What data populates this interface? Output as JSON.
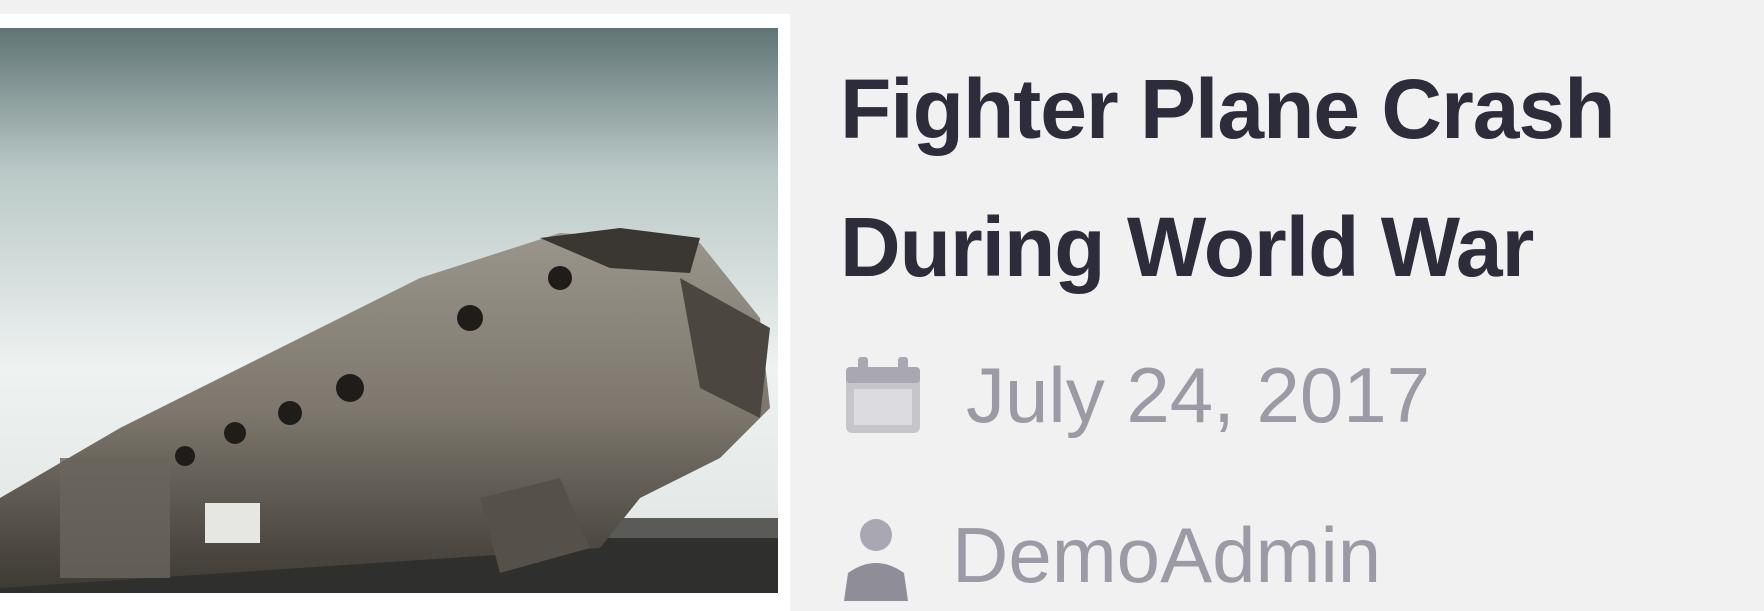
{
  "post": {
    "title": "Fighter Plane Crash During World War",
    "date": "July 24, 2017",
    "author": "DemoAdmin",
    "thumbnail_alt": "Wrecked fighter plane fuselage",
    "icons": {
      "date": "calendar-icon",
      "author": "user-icon"
    }
  },
  "colors": {
    "title": "#2c2c3a",
    "meta": "#9c9aa4",
    "background": "#f1f1f1"
  }
}
